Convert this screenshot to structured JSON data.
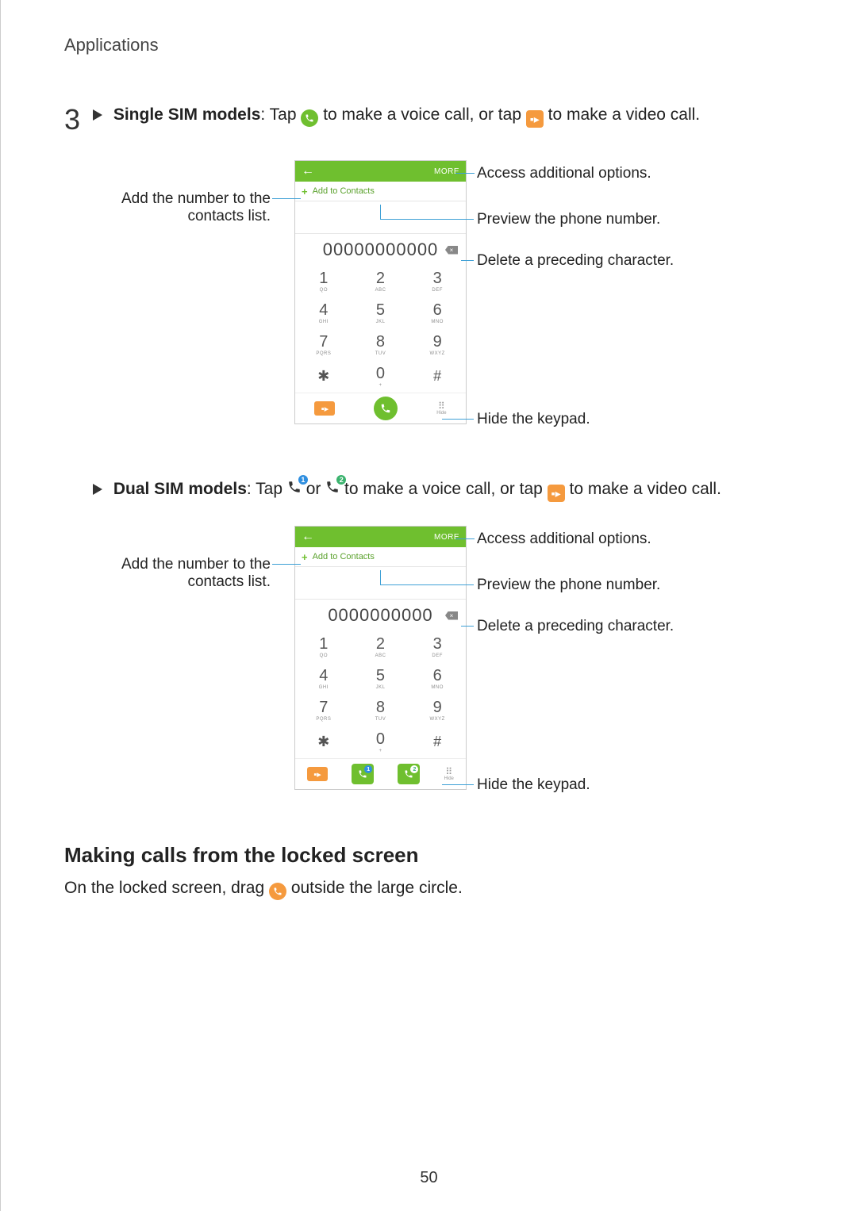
{
  "header": {
    "section": "Applications"
  },
  "step": {
    "number": "3",
    "single": {
      "label_bold": "Single SIM models",
      "t1": ": Tap ",
      "t2": " to make a voice call, or tap ",
      "t3": " to make a video call."
    },
    "dual": {
      "label_bold": "Dual SIM models",
      "t1": ": Tap ",
      "t_or": " or ",
      "t2": " to make a voice call, or tap ",
      "t3": " to make a video call."
    }
  },
  "phone_ui": {
    "more": "MORE",
    "add_contacts": "Add to Contacts",
    "number_single": "00000000000",
    "number_dual": "0000000000",
    "keys": [
      {
        "d": "1",
        "s": "QO"
      },
      {
        "d": "2",
        "s": "ABC"
      },
      {
        "d": "3",
        "s": "DEF"
      },
      {
        "d": "4",
        "s": "GHI"
      },
      {
        "d": "5",
        "s": "JKL"
      },
      {
        "d": "6",
        "s": "MNO"
      },
      {
        "d": "7",
        "s": "PQRS"
      },
      {
        "d": "8",
        "s": "TUV"
      },
      {
        "d": "9",
        "s": "WXYZ"
      },
      {
        "d": "✱",
        "s": ""
      },
      {
        "d": "0",
        "s": "+"
      },
      {
        "d": "#",
        "s": ""
      }
    ],
    "hide": "Hide"
  },
  "callouts": {
    "add_contact": "Add the number to the contacts list.",
    "more": "Access additional options.",
    "preview": "Preview the phone number.",
    "delete": "Delete a preceding character.",
    "hide": "Hide the keypad."
  },
  "section2": {
    "heading": "Making calls from the locked screen",
    "body_1": "On the locked screen, drag ",
    "body_2": " outside the large circle."
  },
  "page_number": "50"
}
